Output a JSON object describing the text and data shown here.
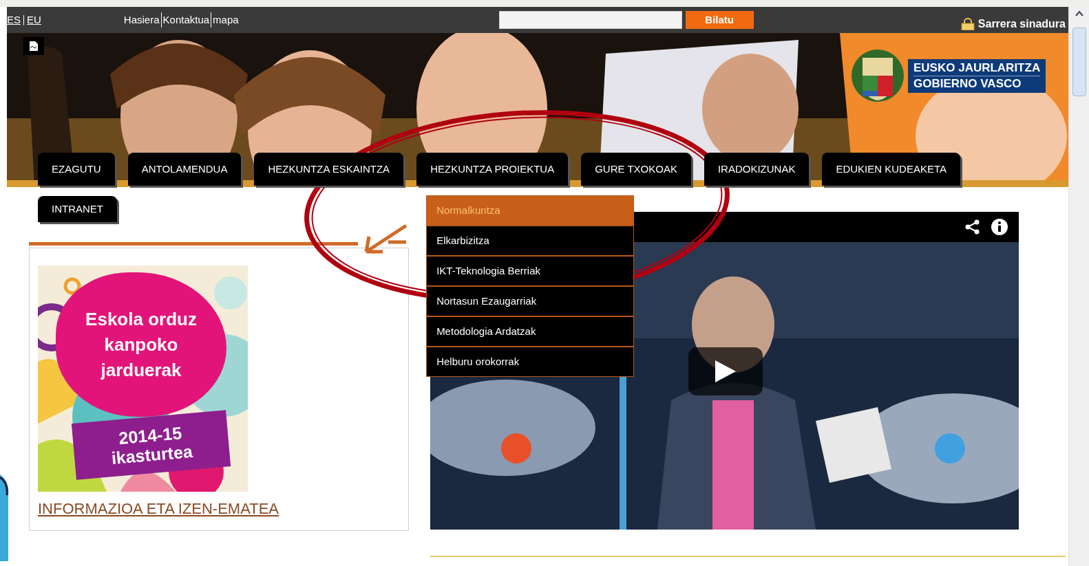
{
  "language_links": [
    "ES",
    "EU"
  ],
  "top_links": [
    "Hasiera",
    "Kontaktua",
    "mapa"
  ],
  "search": {
    "button": "Bilatu"
  },
  "login": {
    "label": "Sarrera sinadura"
  },
  "logo": {
    "line_1": "EUSKO JAURLARITZA",
    "line_2": "GOBIERNO VASCO"
  },
  "nav": [
    {
      "label": "EZAGUTU"
    },
    {
      "label": "ANTOLAMENDUA"
    },
    {
      "label": "HEZKUNTZA ESKAINTZA"
    },
    {
      "label": "HEZKUNTZA PROIEKTUA",
      "children": [
        {
          "label": "Normalkuntza",
          "selected": true
        },
        {
          "label": "Elkarbizitza",
          "selected": false
        },
        {
          "label": "IKT-Teknologia Berriak",
          "selected": false
        },
        {
          "label": "Nortasun Ezaugarriak",
          "selected": false
        },
        {
          "label": "Metodologia Ardatzak",
          "selected": false
        },
        {
          "label": "Helburu orokorrak",
          "selected": false
        }
      ]
    },
    {
      "label": "GURE TXOKOAK"
    },
    {
      "label": "IRADOKIZUNAK"
    },
    {
      "label": "EDUKIEN KUDEAKETA"
    },
    {
      "label": "INTRANET"
    }
  ],
  "promo": {
    "title_lines": [
      "Eskola orduz",
      "kanpoko",
      "jarduerak"
    ],
    "badge_lines": [
      "2014-15",
      "ikasturtea"
    ],
    "link": "INFORMAZIOA ETA IZEN-EMATEA"
  }
}
